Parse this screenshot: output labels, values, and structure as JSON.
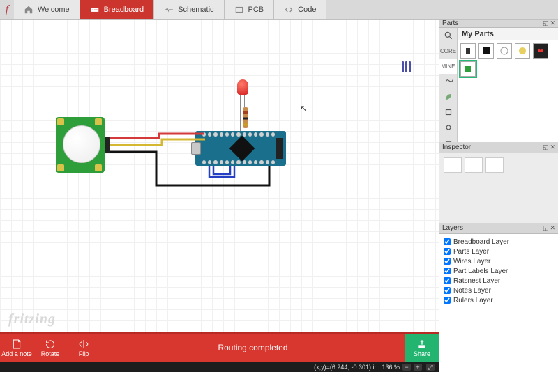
{
  "tabs": {
    "welcome": "Welcome",
    "breadboard": "Breadboard",
    "schematic": "Schematic",
    "pcb": "PCB",
    "code": "Code"
  },
  "watermark": "fritzing",
  "routing_status": "Routing completed",
  "toolbar": {
    "add_note": "Add a note",
    "rotate": "Rotate",
    "flip": "Flip",
    "share": "Share"
  },
  "status": {
    "coords_label": "(x,y)=(6.244, -0.301) in",
    "zoom": "136 %"
  },
  "panels": {
    "parts_title": "Parts",
    "inspector_title": "Inspector",
    "layers_title": "Layers",
    "my_parts": "My Parts",
    "bins": {
      "core": "CORE",
      "mine": "MINE"
    }
  },
  "layers": [
    "Breadboard Layer",
    "Parts Layer",
    "Wires Layer",
    "Part Labels Layer",
    "Ratsnest Layer",
    "Notes Layer",
    "Rulers Layer"
  ],
  "circuit": {
    "components": [
      {
        "name": "PIR motion sensor",
        "kind": "sensor-pir"
      },
      {
        "name": "Arduino Nano",
        "kind": "microcontroller"
      },
      {
        "name": "Red LED 5mm",
        "kind": "led",
        "color": "#d42020"
      },
      {
        "name": "Resistor",
        "kind": "resistor"
      }
    ],
    "wires": [
      {
        "color": "#d43a3a",
        "desc": "PIR VCC to Nano 5V"
      },
      {
        "color": "#d6b733",
        "desc": "PIR OUT to Nano digital"
      },
      {
        "color": "#111111",
        "desc": "PIR GND to Nano GND"
      },
      {
        "color": "#2540c2",
        "desc": "Nano signal wires"
      }
    ]
  }
}
